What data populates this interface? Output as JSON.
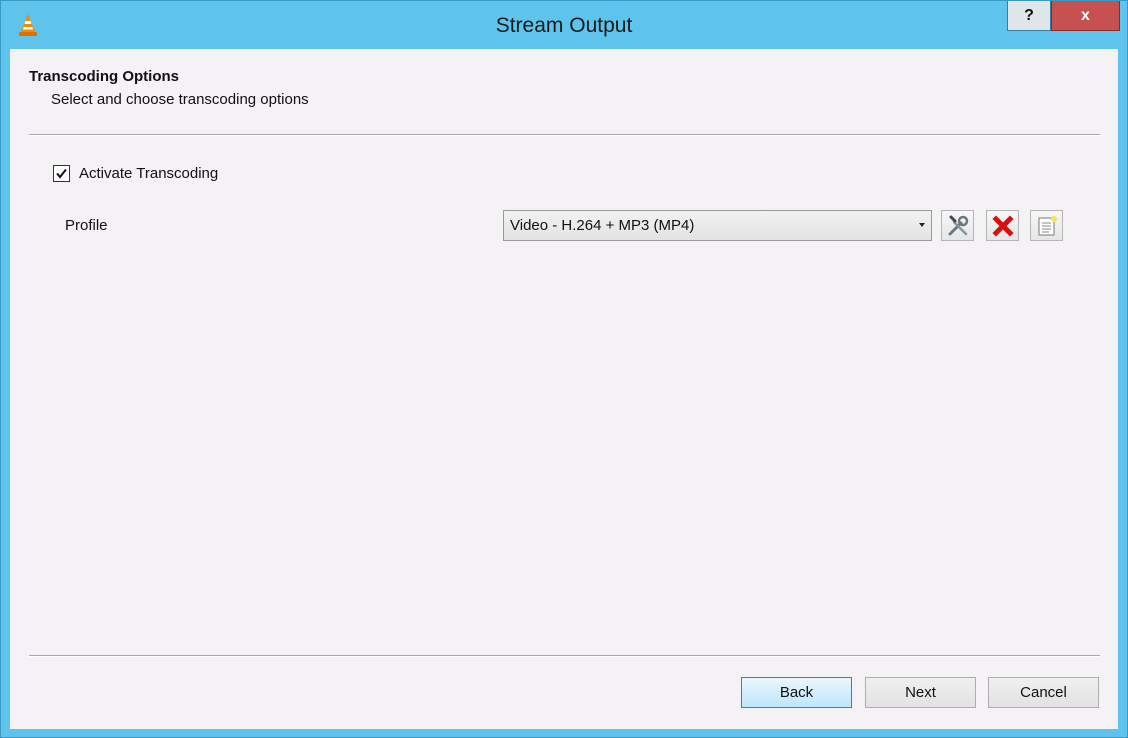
{
  "window": {
    "title": "Stream Output",
    "help_label": "?",
    "close_label": "x"
  },
  "header": {
    "title": "Transcoding Options",
    "subtitle": "Select and choose transcoding options"
  },
  "transcoding": {
    "activate_label": "Activate Transcoding",
    "activate_checked": true,
    "profile_label": "Profile",
    "profile_selected": "Video - H.264 + MP3 (MP4)"
  },
  "icons": {
    "app": "vlc-cone-icon",
    "edit": "wrench-screwdriver-icon",
    "delete": "red-x-icon",
    "new": "new-document-icon"
  },
  "buttons": {
    "back": "Back",
    "next": "Next",
    "cancel": "Cancel"
  }
}
